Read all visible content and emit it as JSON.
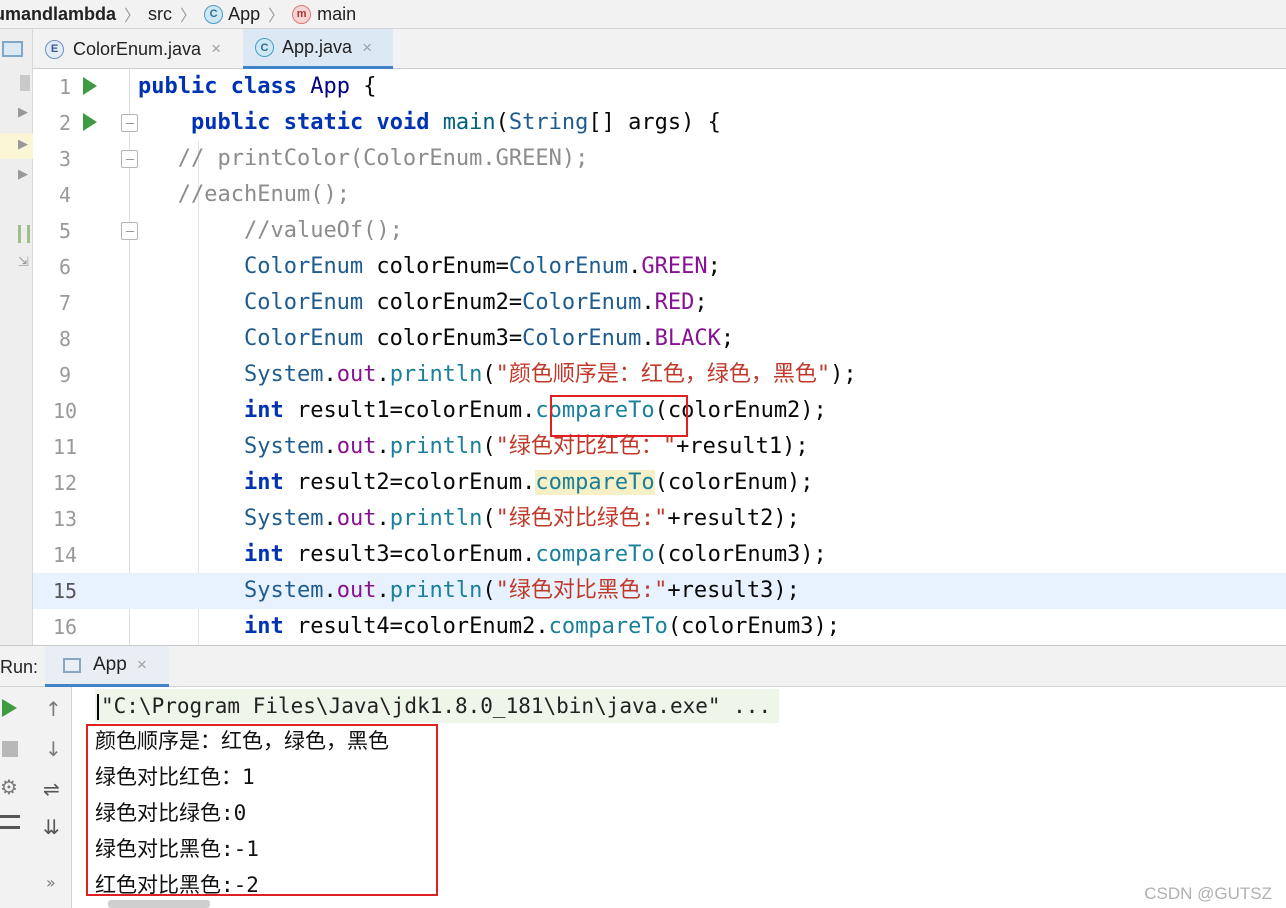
{
  "breadcrumb": {
    "project": "umandlambda",
    "folder": "src",
    "class": "App",
    "method": "main",
    "class_icon": "C",
    "method_icon": "m"
  },
  "tabs": [
    {
      "label": "ColorEnum.java",
      "icon": "E",
      "close": "×",
      "active": false
    },
    {
      "label": "App.java",
      "icon": "C",
      "close": "×",
      "active": true
    }
  ],
  "editor": {
    "current_line": 15,
    "lines": [
      {
        "num": "1"
      },
      {
        "num": "2"
      },
      {
        "num": "3"
      },
      {
        "num": "4"
      },
      {
        "num": "5"
      },
      {
        "num": "6"
      },
      {
        "num": "7"
      },
      {
        "num": "8"
      },
      {
        "num": "9"
      },
      {
        "num": "10"
      },
      {
        "num": "11"
      },
      {
        "num": "12"
      },
      {
        "num": "13"
      },
      {
        "num": "14"
      },
      {
        "num": "15"
      },
      {
        "num": "16"
      }
    ],
    "code": {
      "l1": {
        "kw1": "public",
        "kw2": "class",
        "name": "App",
        "brace": "{"
      },
      "l2": {
        "kw1": "public",
        "kw2": "static",
        "kw3": "void",
        "method": "main",
        "params_open": "(",
        "type": "String",
        "rest": "[] args) {"
      },
      "l3": "// printColor(ColorEnum.GREEN);",
      "l4": "//eachEnum();",
      "l5": "//valueOf();",
      "l6": {
        "type": "ColorEnum",
        "var": " colorEnum=",
        "type2": "ColorEnum",
        "dot": ".",
        "field": "GREEN",
        "end": ";"
      },
      "l7": {
        "type": "ColorEnum",
        "var": " colorEnum2=",
        "type2": "ColorEnum",
        "dot": ".",
        "field": "RED",
        "end": ";"
      },
      "l8": {
        "type": "ColorEnum",
        "var": " colorEnum3=",
        "type2": "ColorEnum",
        "dot": ".",
        "field": "BLACK",
        "end": ";"
      },
      "l9": {
        "sys": "System",
        "dot": ".",
        "out": "out",
        "dot2": ".",
        "call": "println",
        "open": "(",
        "str": "\"颜色顺序是：红色，绿色，黑色\"",
        "end": ");"
      },
      "l10": {
        "kw": "int",
        "pre": " result1=colorEnum.",
        "call": "compareTo",
        "post": "(colorEnum2);"
      },
      "l11": {
        "sys": "System",
        "dot": ".",
        "out": "out",
        "dot2": ".",
        "call": "println",
        "open": "(",
        "str": "\"绿色对比红色：\"",
        "end": "+result1);"
      },
      "l12": {
        "kw": "int",
        "pre": " result2=colorEnum.",
        "call": "compareTo",
        "post": "(colorEnum);"
      },
      "l13": {
        "sys": "System",
        "dot": ".",
        "out": "out",
        "dot2": ".",
        "call": "println",
        "open": "(",
        "str": "\"绿色对比绿色:\"",
        "end": "+result2);"
      },
      "l14": {
        "kw": "int",
        "pre": " result3=colorEnum.",
        "call": "compareTo",
        "post": "(colorEnum3);"
      },
      "l15": {
        "sys": "System",
        "dot": ".",
        "out": "out",
        "dot2": ".",
        "call": "println",
        "open": "(",
        "str": "\"绿色对比黑色:\"",
        "end": "+result3);"
      },
      "l16": {
        "kw": "int",
        "pre": " result4=colorEnum2.",
        "call": "compareTo",
        "post": "(colorEnum3);"
      }
    }
  },
  "run": {
    "label": "Run:",
    "tab_label": "App",
    "close": "×",
    "command": "\"C:\\Program Files\\Java\\jdk1.8.0_181\\bin\\java.exe\" ...",
    "output": [
      "颜色顺序是：红色，绿色，黑色",
      "绿色对比红色：1",
      "绿色对比绿色:0",
      "绿色对比黑色:-1",
      "红色对比黑色:-2"
    ],
    "toolbar_more": "»"
  },
  "watermark": "CSDN @GUTSZ",
  "colors": {
    "keyword": "#0033b3",
    "field": "#871094",
    "string": "#c03a2b",
    "method_call": "#1a7f9a",
    "run_green": "#3f9b41",
    "annotation_red": "#e02020",
    "current_line_bg": "#e8f2fe"
  }
}
